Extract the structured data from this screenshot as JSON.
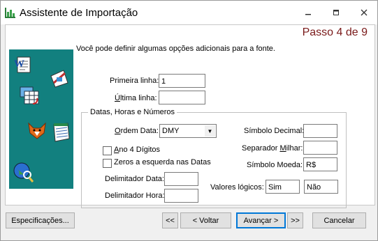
{
  "window": {
    "title": "Assistente de Importação"
  },
  "step": "Passo 4 de 9",
  "intro": "Você pode definir algumas opções adicionais para a fonte.",
  "primeira_linha": {
    "label": "Primeira linha:",
    "value": "1"
  },
  "ultima_linha": {
    "label": "Última linha:",
    "value": ""
  },
  "group_title": "Datas, Horas e Números",
  "ordem_data": {
    "label": "Ordem Data:",
    "value": "DMY"
  },
  "ano4": {
    "label": "Ano 4 Dígitos"
  },
  "zeros": {
    "label": "Zeros a esquerda nas Datas"
  },
  "delim_data": {
    "label": "Delimitador Data:",
    "value": ""
  },
  "delim_hora": {
    "label": "Delimitador Hora:",
    "value": ""
  },
  "simbolo_decimal": {
    "label": "Símbolo Decimal:",
    "value": ""
  },
  "separador_milhar": {
    "label": "Separador Milhar:",
    "value": ""
  },
  "simbolo_moeda": {
    "label": "Símbolo Moeda:",
    "value": "R$"
  },
  "valores_logicos": {
    "label": "Valores lógicos:",
    "true_value": "Sim",
    "false_value": "Não"
  },
  "buttons": {
    "especificacoes": "Especificações...",
    "first": "<<",
    "voltar": "< Voltar",
    "avancar": "Avançar >",
    "last": ">>",
    "cancelar": "Cancelar"
  }
}
